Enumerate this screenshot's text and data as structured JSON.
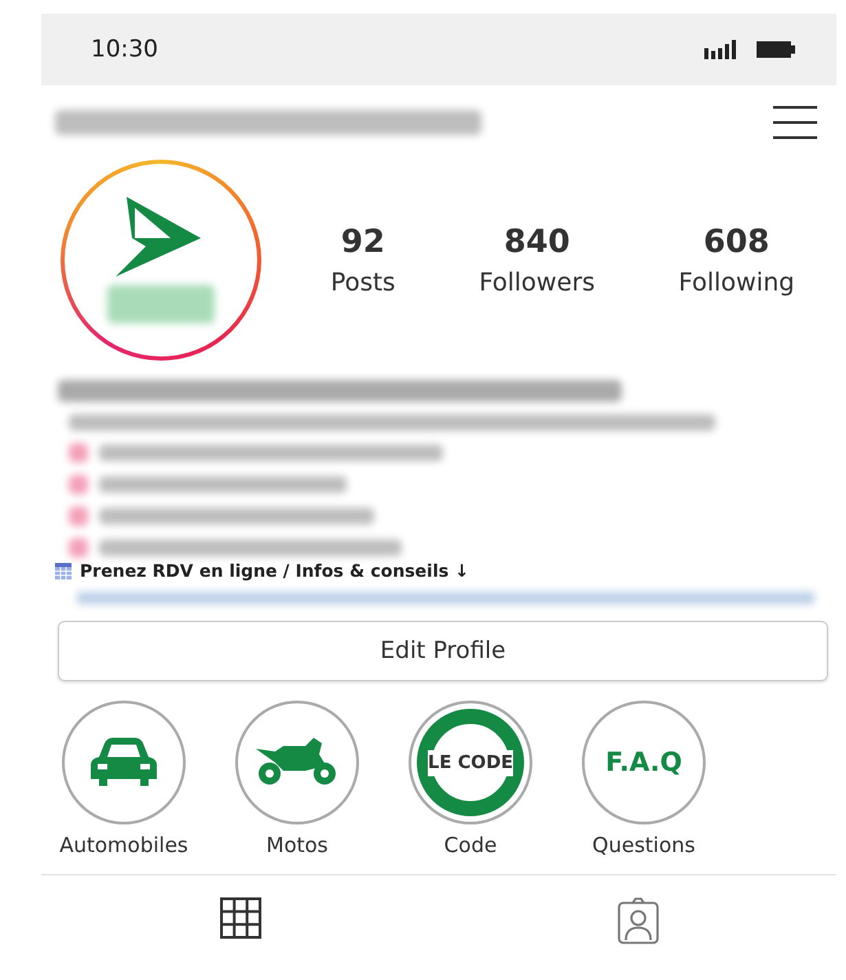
{
  "status_bar": {
    "time": "10:30"
  },
  "stats": [
    {
      "value": "92",
      "label": "Posts"
    },
    {
      "value": "840",
      "label": "Followers"
    },
    {
      "value": "608",
      "label": "Following"
    }
  ],
  "bio": {
    "link_line": "Prenez RDV en ligne / Infos & conseils ↓"
  },
  "edit_button": "Edit Profile",
  "highlights": [
    {
      "kind": "car",
      "label": "Automobiles"
    },
    {
      "kind": "moto",
      "label": "Motos"
    },
    {
      "kind": "badge",
      "text": "LE CODE",
      "label": "Code"
    },
    {
      "kind": "text",
      "text": "F.A.Q",
      "label": "Questions"
    }
  ],
  "tabs": [
    {
      "kind": "grid"
    },
    {
      "kind": "tagged"
    }
  ]
}
